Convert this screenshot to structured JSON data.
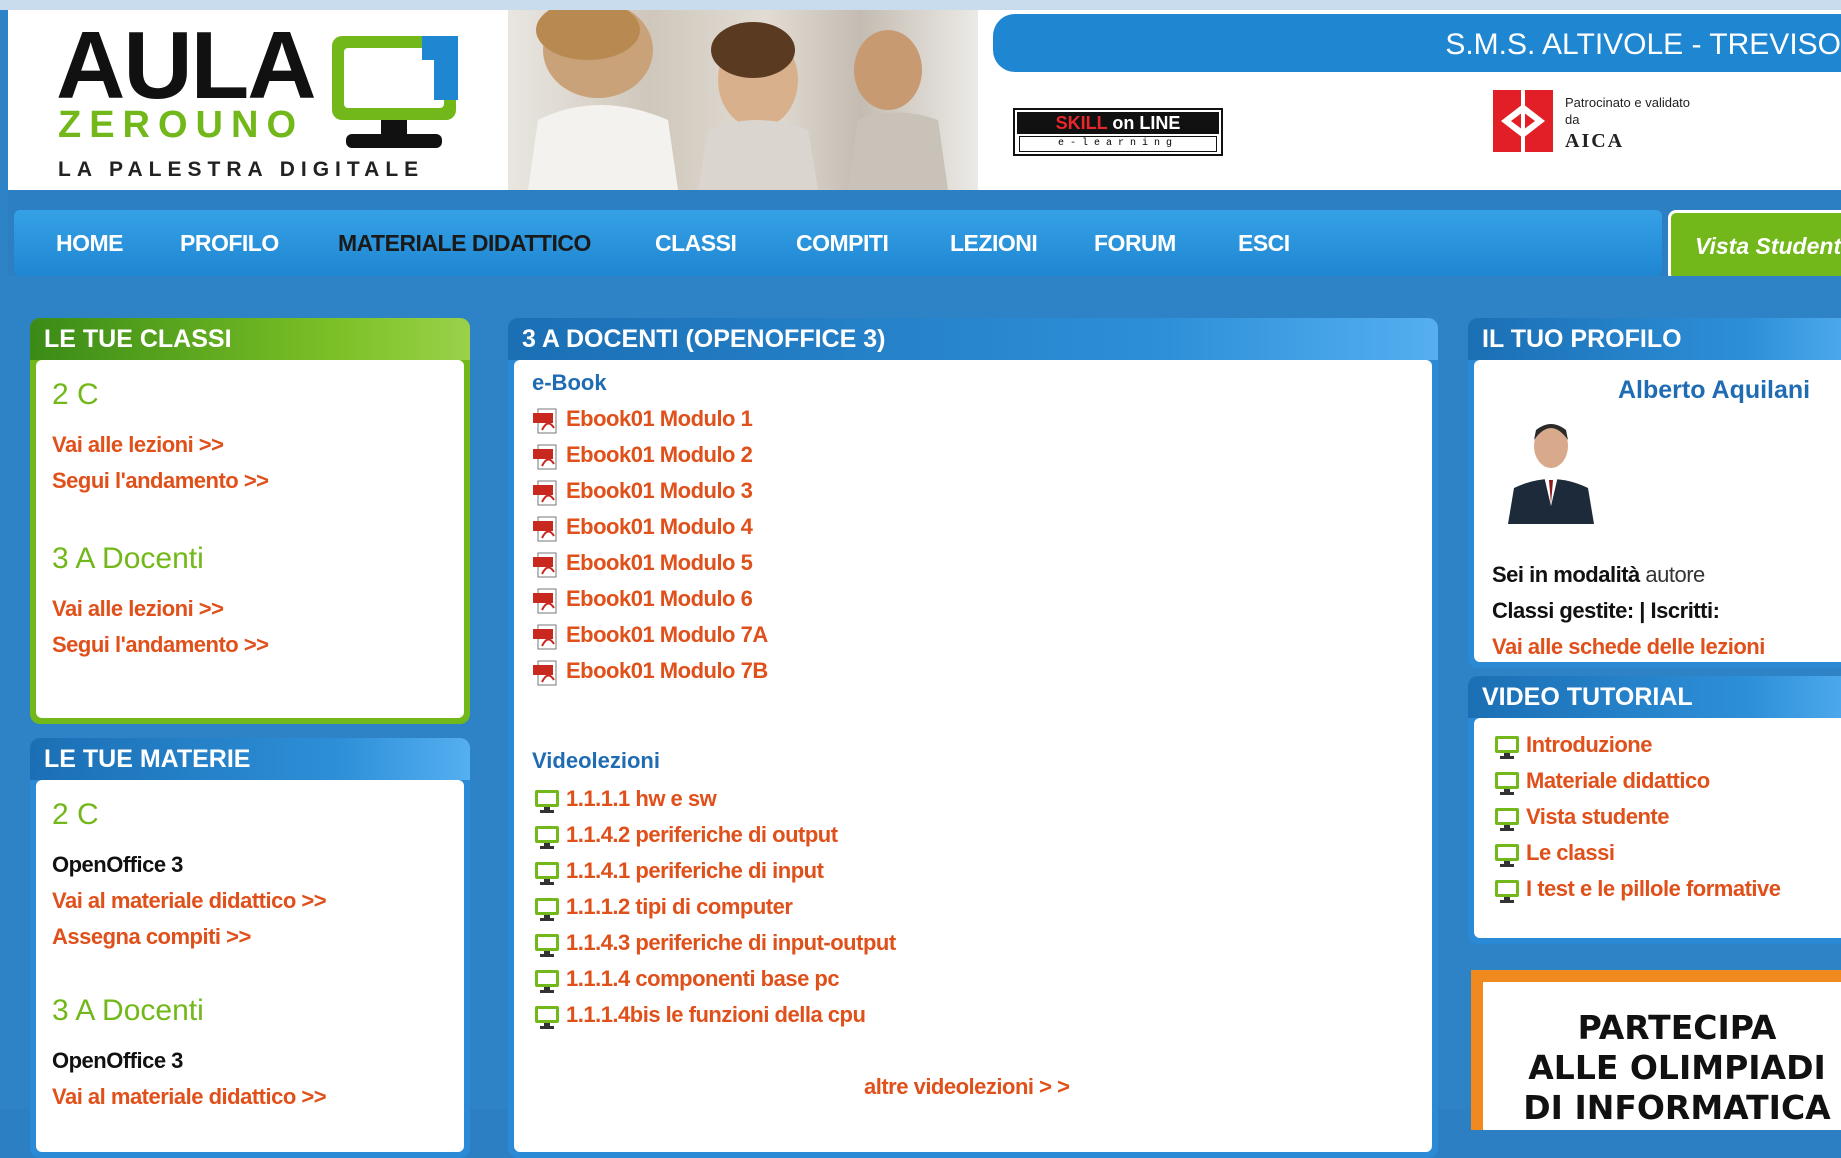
{
  "header": {
    "logo_main": "AULA",
    "logo_sub": "ZEROUNO",
    "logo_tagline": "LA PALESTRA DIGITALE",
    "school_name": "S.M.S. ALTIVOLE - TREVISO",
    "skill_logo_top_a": "SKILL",
    "skill_logo_top_b": " on LINE",
    "skill_logo_bottom": "e-learning",
    "aica_text": "Patrocinato e validato da",
    "aica_name": "AICA"
  },
  "nav": {
    "items": [
      "HOME",
      "PROFILO",
      "MATERIALE DIDATTICO",
      "CLASSI",
      "COMPITI",
      "LEZIONI",
      "FORUM",
      "ESCI"
    ],
    "active": "MATERIALE DIDATTICO",
    "vista": "Vista Studente"
  },
  "classes_panel": {
    "title": "LE TUE CLASSI",
    "classes": [
      {
        "name": "2 C",
        "link1": "Vai alle lezioni >>",
        "link2": "Segui l'andamento >>"
      },
      {
        "name": "3 A Docenti",
        "link1": "Vai alle lezioni >>",
        "link2": "Segui l'andamento >>"
      }
    ]
  },
  "subjects_panel": {
    "title": "LE TUE MATERIE",
    "subjects": [
      {
        "name": "2 C",
        "course": "OpenOffice 3",
        "link1": "Vai al materiale didattico >>",
        "link2": "Assegna compiti >>"
      },
      {
        "name": "3 A Docenti",
        "course": "OpenOffice 3",
        "link1": "Vai al materiale didattico >>"
      }
    ]
  },
  "main_panel": {
    "title": "3 A DOCENTI (OPENOFFICE 3)",
    "ebook_heading": "e-Book",
    "ebooks": [
      "Ebook01 Modulo 1",
      "Ebook01 Modulo 2",
      "Ebook01 Modulo 3",
      "Ebook01 Modulo 4",
      "Ebook01 Modulo 5",
      "Ebook01 Modulo 6",
      "Ebook01 Modulo 7A",
      "Ebook01 Modulo 7B"
    ],
    "video_heading": "Videolezioni",
    "videos": [
      "1.1.1.1 hw e sw",
      "1.1.4.2 periferiche di output",
      "1.1.4.1 periferiche di input",
      "1.1.1.2 tipi di computer",
      "1.1.4.3 periferiche di input-output",
      "1.1.1.4 componenti base pc",
      "1.1.1.4bis le funzioni della cpu"
    ],
    "more_link": "altre videolezioni > >"
  },
  "profile_panel": {
    "title": "IL TUO PROFILO",
    "user_name": "Alberto Aquilani",
    "mode_label": "Sei in modalità",
    "mode_value": "autore",
    "classes_line": "Classi gestite: | Iscritti:",
    "link": "Vai alle schede delle lezioni"
  },
  "video_tutorial_panel": {
    "title": "VIDEO TUTORIAL",
    "items": [
      "Introduzione",
      "Materiale didattico",
      "Vista studente",
      "Le classi",
      "I test e le pillole formative"
    ]
  },
  "olimpiadi": {
    "line1": "PARTECIPA",
    "line2": "ALLE OLIMPIADI",
    "line3": "DI INFORMATICA"
  },
  "colors": {
    "accent_blue": "#2d7fc4",
    "green": "#72b81a",
    "link_orange": "#e0501b",
    "heading_blue": "#1f6cb3"
  }
}
